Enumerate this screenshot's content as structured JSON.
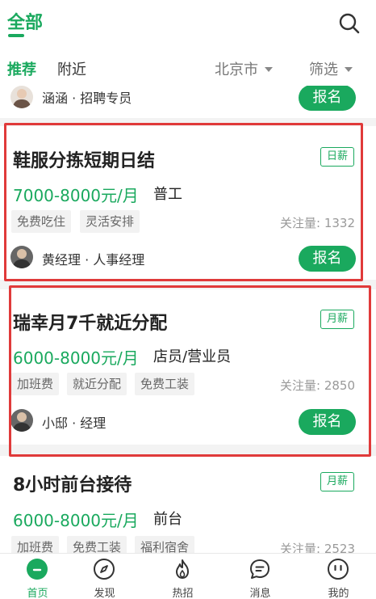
{
  "header": {
    "title": "全部"
  },
  "filters": {
    "tabs": [
      "推荐",
      "附近"
    ],
    "city": "北京市",
    "filter": "筛选"
  },
  "partial_card": {
    "recruiter": "涵涵 · 招聘专员",
    "apply": "报名"
  },
  "jobs": [
    {
      "title": "鞋服分拣短期日结",
      "pay_type": "日薪",
      "salary": "7000-8000元/月",
      "role": "普工",
      "tags": [
        "免费吃住",
        "灵活安排"
      ],
      "watch": "关注量: 1332",
      "recruiter": "黄经理 · 人事经理",
      "apply": "报名"
    },
    {
      "title": "瑞幸月7千就近分配",
      "pay_type": "月薪",
      "salary": "6000-8000元/月",
      "role": "店员/营业员",
      "tags": [
        "加班费",
        "就近分配",
        "免费工装"
      ],
      "watch": "关注量: 2850",
      "recruiter": "小邸 · 经理",
      "apply": "报名"
    },
    {
      "title": "8小时前台接待",
      "pay_type": "月薪",
      "salary": "6000-8000元/月",
      "role": "前台",
      "tags": [
        "加班费",
        "免费工装",
        "福利宿舍"
      ],
      "watch": "关注量: 2523"
    }
  ],
  "nav": {
    "items": [
      {
        "label": "首页",
        "icon": "home-icon"
      },
      {
        "label": "发现",
        "icon": "compass-icon"
      },
      {
        "label": "热招",
        "icon": "flame-icon"
      },
      {
        "label": "消息",
        "icon": "message-icon"
      },
      {
        "label": "我的",
        "icon": "profile-icon"
      }
    ]
  },
  "colors": {
    "accent": "#1aa95e",
    "highlight": "#e03a3a"
  }
}
